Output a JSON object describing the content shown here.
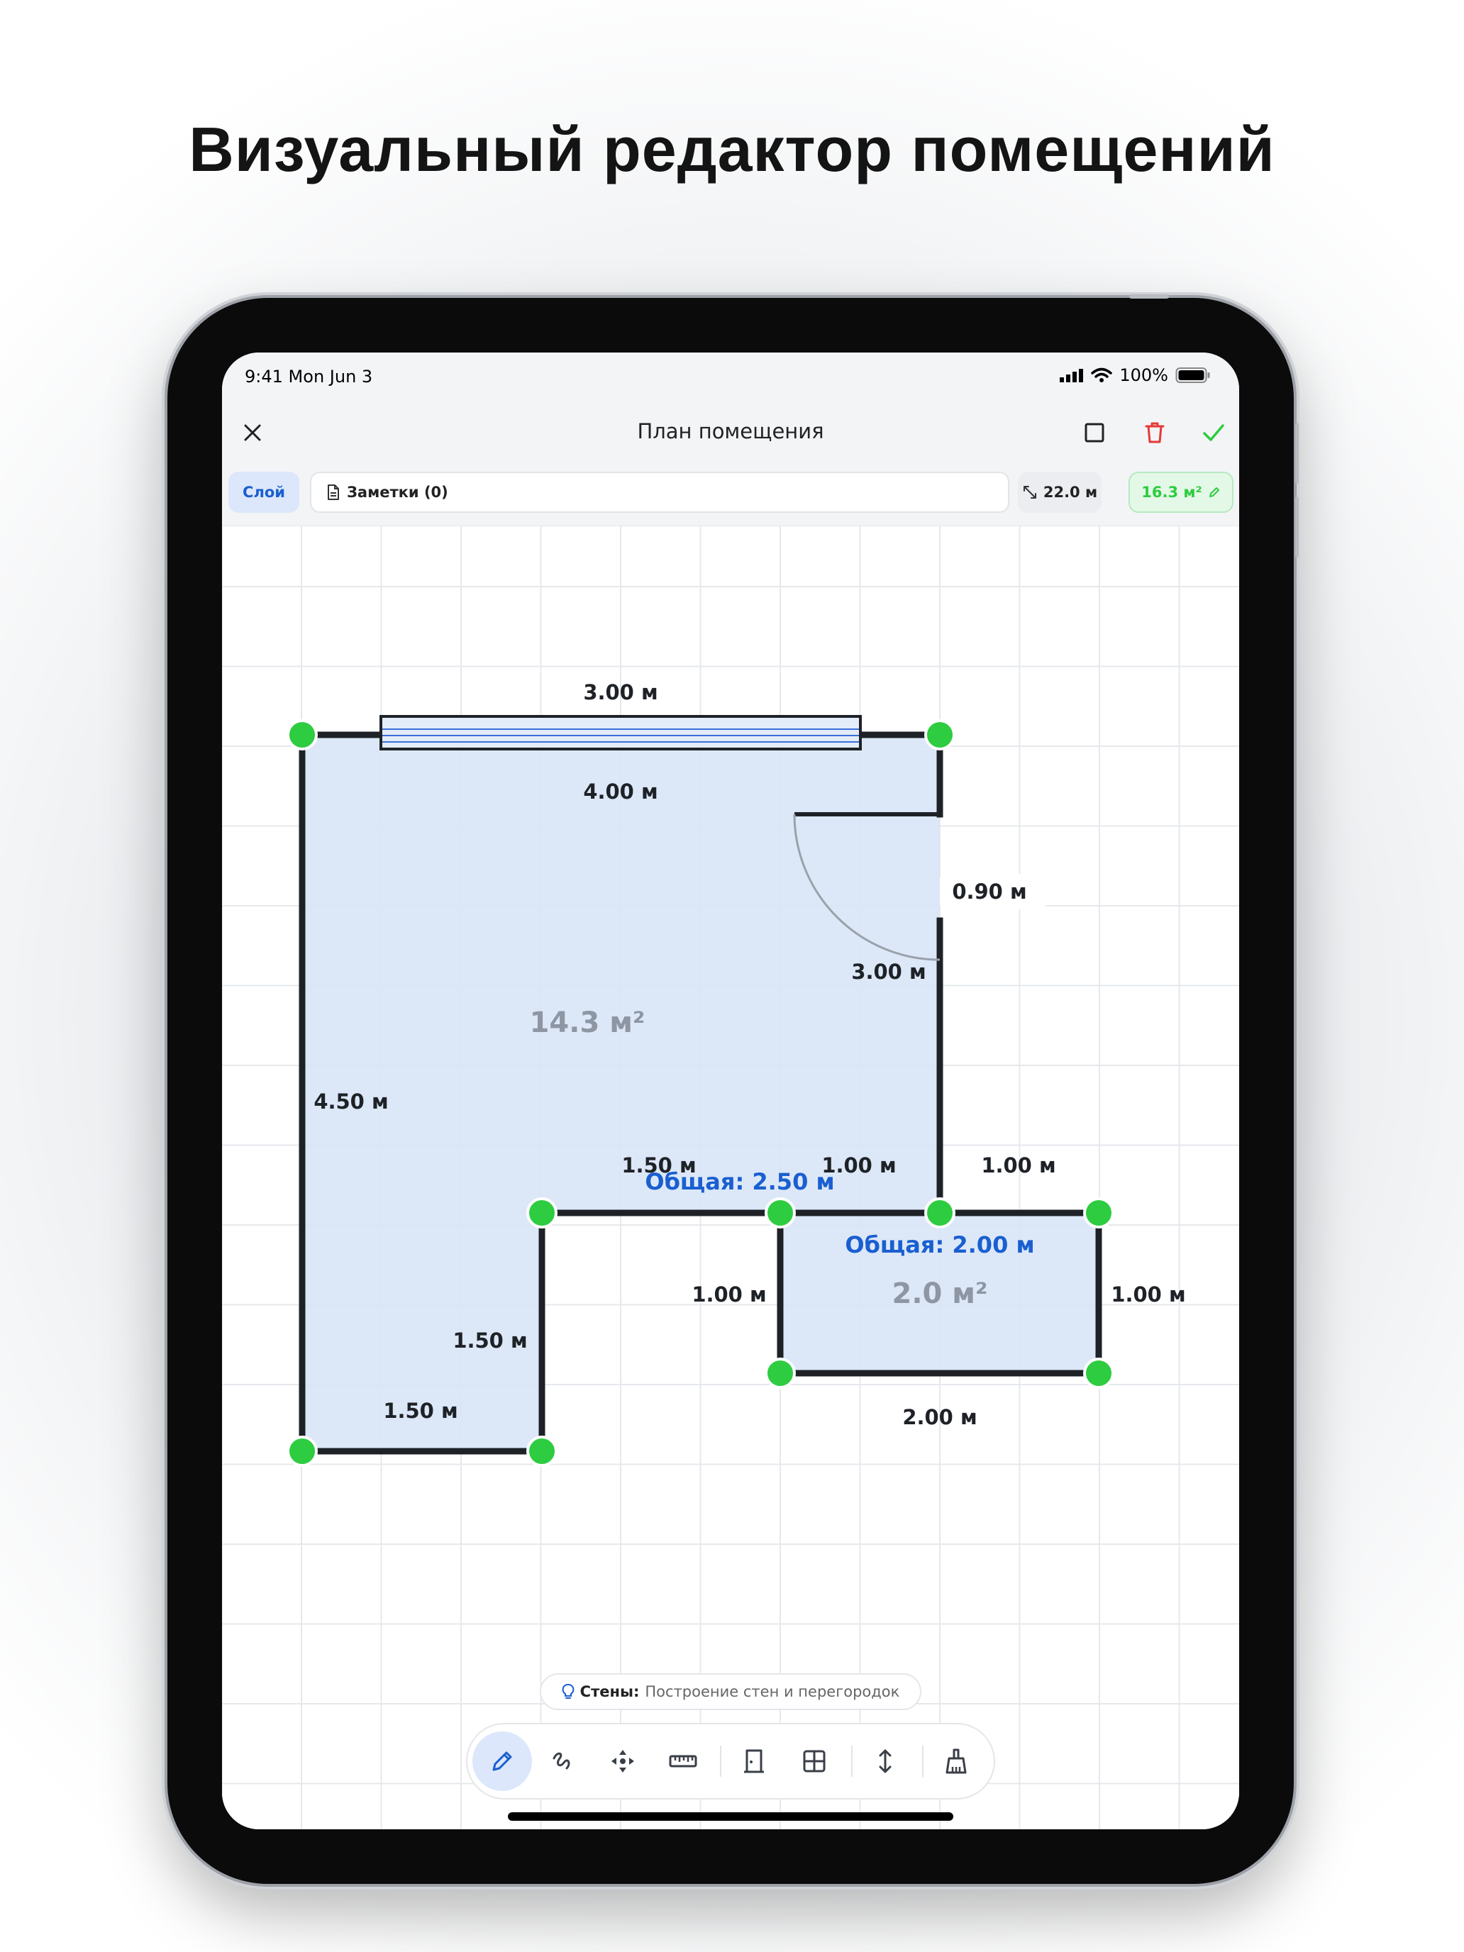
{
  "headline": "Визуальный редактор помещений",
  "status_bar": {
    "time": "9:41",
    "date": "Mon Jun 3",
    "battery": "100%"
  },
  "navbar": {
    "title": "План помещения",
    "close_icon": "close-icon",
    "select_icon": "square-icon",
    "delete_icon": "trash-icon",
    "confirm_icon": "checkmark-icon"
  },
  "toolbar": {
    "layer_label": "Слой",
    "notes_label": "Заметки (0)",
    "perimeter": "22.0 м",
    "area": "16.3 м²"
  },
  "plan": {
    "room1_area": "14.3 м²",
    "room2_area": "2.0 м²",
    "dims": {
      "window_width": "3.00 м",
      "top_wall": "4.00 м",
      "door_width": "0.90 м",
      "right_wall": "3.00 м",
      "left_wall": "4.50 м",
      "mid_wall_left": "1.50 м",
      "mid_wall_right": "1.00 м",
      "room2_top": "1.00 м",
      "inner_vertical": "1.50 м",
      "bottom_wall": "1.50 м",
      "room2_left": "1.00 м",
      "room2_right": "1.00 м",
      "room2_bottom": "2.00 м"
    },
    "totals": {
      "total1": "Общая: 2.50 м",
      "total2": "Общая: 2.00 м"
    }
  },
  "hint": {
    "title": "Стены:",
    "text": "Построение стен и перегородок"
  },
  "tools": [
    {
      "name": "pencil-icon",
      "active": true
    },
    {
      "name": "freehand-icon",
      "active": false
    },
    {
      "name": "move-icon",
      "active": false
    },
    {
      "name": "ruler-icon",
      "active": false
    },
    {
      "name": "door-icon",
      "active": false
    },
    {
      "name": "window-icon",
      "active": false
    },
    {
      "name": "height-icon",
      "active": false
    },
    {
      "name": "broom-icon",
      "active": false
    }
  ],
  "colors": {
    "accent_blue": "#1a5fd0",
    "accent_green": "#2ecc40",
    "delete_red": "#e53935",
    "room_fill": "#d8e5f7",
    "wall": "#1e2227"
  }
}
